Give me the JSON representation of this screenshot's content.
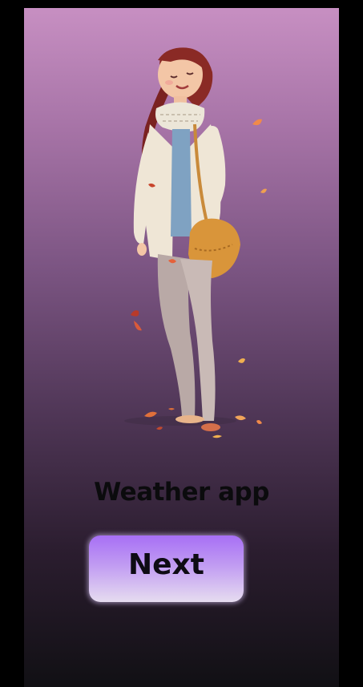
{
  "app": {
    "title": "Weather app"
  },
  "actions": {
    "next_label": "Next"
  },
  "illustration": {
    "subject": "woman-with-autumn-leaves-illustration"
  },
  "colors": {
    "gradient_top": "#c78fc2",
    "gradient_bottom": "#111014",
    "button_top": "#a76ff5",
    "button_bottom": "#e6dcf0",
    "title_text": "#0b0b0d"
  }
}
